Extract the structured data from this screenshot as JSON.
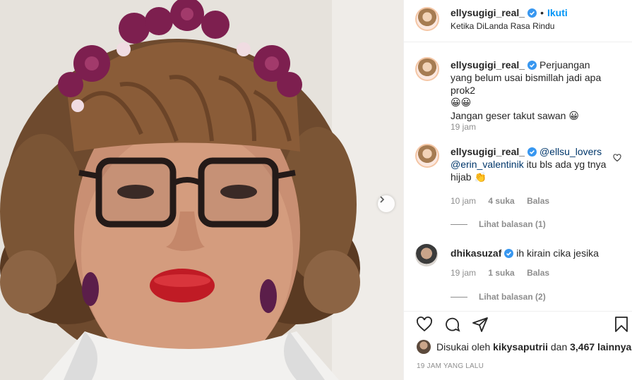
{
  "post": {
    "username": "ellysugigi_real_",
    "follow_sep": "•",
    "follow_label": "Ikuti",
    "location": "Ketika DiLanda Rasa Rindu"
  },
  "comments": [
    {
      "username": "ellysugigi_real_",
      "text_line1": "Perjuangan yang belum usai bismillah jadi apa prok2",
      "emoji_line": "😀😀",
      "text_line2": "Jangan geser takut sawan",
      "emoji_end": "😀",
      "time": "19 jam"
    },
    {
      "username": "ellysugigi_real_",
      "mention1": "@ellsu_lovers",
      "mention2": "@erin_valentinik",
      "text": "itu bls ada yg tnya hijab",
      "emoji": "👏",
      "time": "10 jam",
      "likes": "4 suka",
      "reply": "Balas",
      "view_replies": "Lihat balasan (1)"
    },
    {
      "username": "dhikasuzaf",
      "text": "ih kirain cika jesika",
      "time": "19 jam",
      "likes": "1 suka",
      "reply": "Balas",
      "view_replies": "Lihat balasan (2)"
    }
  ],
  "likes_line": {
    "prefix": "Disukai oleh",
    "user": "kikysaputrii",
    "middle": "dan",
    "count": "3,467 lainnya"
  },
  "timestamp": "19 JAM YANG LALU",
  "colors": {
    "accent_blue": "#0095f6",
    "mention": "#00376b",
    "muted": "#8e8e8e",
    "text": "#262626"
  },
  "icons": [
    "verified-badge-icon",
    "heart-icon",
    "comment-icon",
    "share-icon",
    "bookmark-icon",
    "chevron-right-icon"
  ]
}
